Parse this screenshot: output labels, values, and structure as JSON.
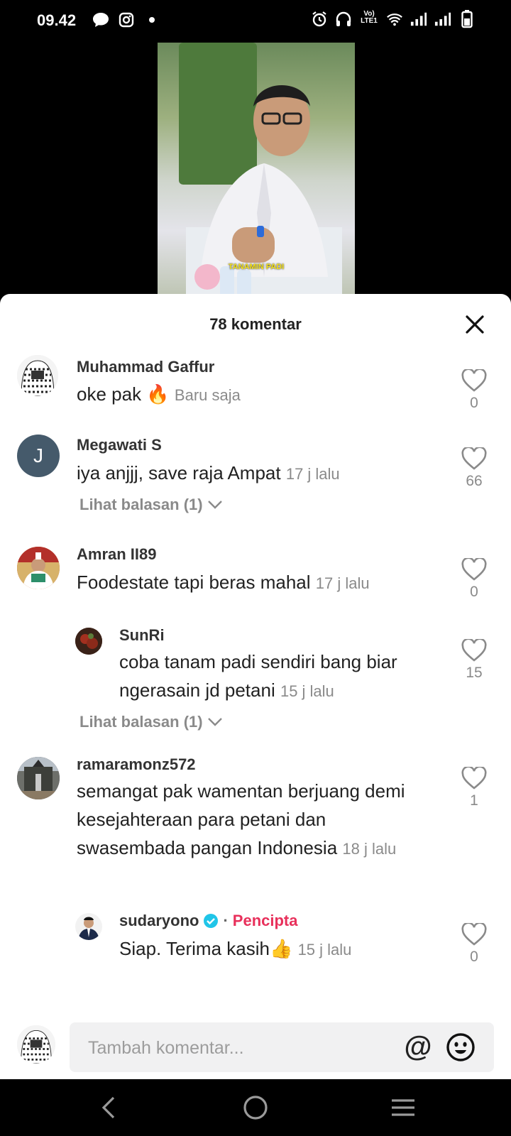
{
  "status_bar": {
    "time": "09.42",
    "net_label": "LTE1"
  },
  "video": {
    "caption": "TANAMIN PADI"
  },
  "sheet": {
    "title": "78 komentar"
  },
  "comments": [
    {
      "user": "Muhammad Gaffur",
      "text": "oke pak 🔥",
      "time": "Baru saja",
      "likes": "0"
    },
    {
      "user": "Megawati S",
      "avatar_letter": "J",
      "text": "iya anjjj, save raja Ampat",
      "time": "17 j lalu",
      "likes": "66",
      "replies": "Lihat balasan (1)"
    },
    {
      "user": "Amran II89",
      "text": "Foodestate tapi beras mahal",
      "time": "17 j lalu",
      "likes": "0"
    },
    {
      "user": "SunRi",
      "text": "coba tanam padi sendiri bang biar ngerasain jd petani",
      "time": "15 j lalu",
      "likes": "15",
      "replies": "Lihat balasan (1)"
    },
    {
      "user": "ramaramonz572",
      "text": "semangat pak wamentan berjuang demi kesejahteraan para petani dan swasembada pangan Indonesia",
      "time": "18 j lalu",
      "likes": "1"
    },
    {
      "user": "sudaryono",
      "badge": "Pencipta",
      "text": "Siap. Terima kasih👍",
      "time": "15 j lalu",
      "likes": "0"
    }
  ],
  "composer": {
    "placeholder": "Tambah komentar...",
    "at_symbol": "@"
  },
  "colors": {
    "creator_badge": "#e8305b",
    "verified": "#20c5e8"
  }
}
